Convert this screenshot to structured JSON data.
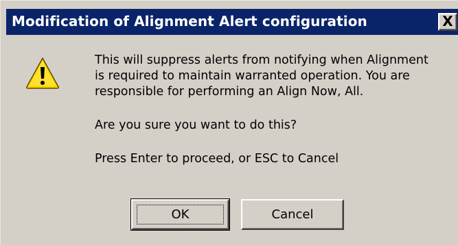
{
  "window": {
    "title": "Modification of Alignment Alert configuration",
    "close_label": "X"
  },
  "icon": {
    "name": "warning-icon",
    "color": "#ffd800"
  },
  "message": {
    "lines": [
      "This will suppress alerts from notifying when Alignment",
      "is required to maintain warranted operation.  You are",
      "responsible for performing an Align Now, All."
    ],
    "question": "Are you sure you want to do this?",
    "instruction": "Press Enter to proceed, or ESC to Cancel"
  },
  "buttons": {
    "ok_label": "OK",
    "cancel_label": "Cancel"
  },
  "colors": {
    "titlebar": "#0a246a",
    "dialog_bg": "#d4d0c8"
  }
}
